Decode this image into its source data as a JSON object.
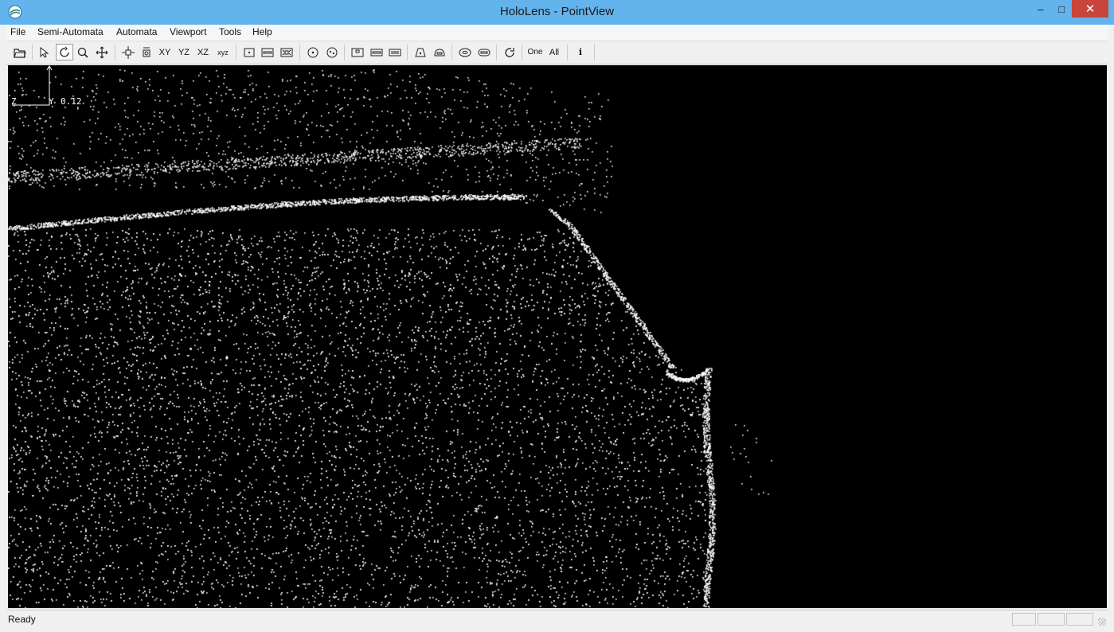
{
  "window": {
    "title": "HoloLens - PointView",
    "controls": {
      "minimize": "–",
      "maximize": "□",
      "close": "✕"
    }
  },
  "menu": {
    "items": [
      {
        "label": "File"
      },
      {
        "label": "Semi-Automata"
      },
      {
        "label": "Automata"
      },
      {
        "label": "Viewport"
      },
      {
        "label": "Tools"
      },
      {
        "label": "Help"
      }
    ]
  },
  "toolbar": {
    "buttons": [
      {
        "icon": "open-folder-icon"
      },
      {
        "icon": "select-arrow-icon"
      },
      {
        "icon": "rotate-icon",
        "active": true
      },
      {
        "icon": "zoom-icon"
      },
      {
        "icon": "pan-icon"
      },
      {
        "icon": "fit-all-icon"
      },
      {
        "icon": "fit-center-icon"
      },
      {
        "icon": "view-xy",
        "text": "XY"
      },
      {
        "icon": "view-yz",
        "text": "YZ"
      },
      {
        "icon": "view-xz",
        "text": "XZ"
      },
      {
        "icon": "view-xyz",
        "text": "xyz"
      },
      {
        "icon": "point-tool-icon"
      },
      {
        "icon": "line-tool-icon"
      },
      {
        "icon": "box-tool-icon"
      },
      {
        "icon": "circle-tool-icon"
      },
      {
        "icon": "sphere-tool-icon"
      },
      {
        "icon": "plane-tool-icon"
      },
      {
        "icon": "cylinder-tool-icon"
      },
      {
        "icon": "pipe-tool-icon"
      },
      {
        "icon": "cone-tool-icon"
      },
      {
        "icon": "torus-tool-icon"
      },
      {
        "icon": "ring-tool-icon"
      },
      {
        "icon": "capsule-tool-icon"
      },
      {
        "icon": "refresh-icon"
      },
      {
        "icon": "one-button",
        "text": "One"
      },
      {
        "icon": "all-button",
        "text": "All"
      },
      {
        "icon": "info-icon",
        "text": "i"
      }
    ]
  },
  "viewport": {
    "axis": {
      "z_label": "Z",
      "y_label": "Y",
      "scale": "0.12"
    },
    "colors": {
      "background": "#000000",
      "points": "#ffffff"
    }
  },
  "status": {
    "text": "Ready"
  }
}
